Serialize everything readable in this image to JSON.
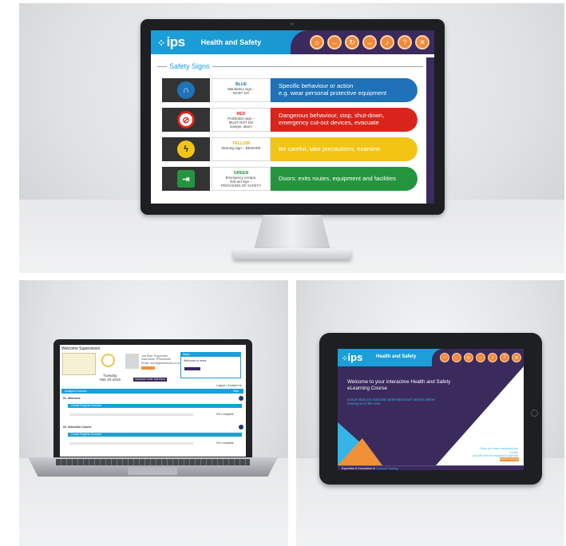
{
  "desktop": {
    "logo": "ips",
    "header_title": "Health and Safety",
    "section_title": "Safety Signs",
    "nav_icons": [
      "home-icon",
      "back-icon",
      "refresh-icon",
      "forward-icon",
      "sound-icon",
      "help-icon",
      "close-icon"
    ],
    "signs": [
      {
        "color_name": "BLUE",
        "desc1": "Mandatory sign –",
        "desc2": "MUST DO",
        "desc3": "",
        "bar_line1": "Specific behaviour or action",
        "bar_line2": "e.g. wear personal protective equipment",
        "color": "#1f72b8",
        "icon": "ear-protection-icon",
        "glyph": "∩"
      },
      {
        "color_name": "RED",
        "desc1": "Prohibition sign –",
        "desc2": "MUST NOT DO",
        "desc3": "Danger, alarm",
        "bar_line1": "Dangerous behaviour, stop, shut-down,",
        "bar_line2": "emergency cut-out devices, evacuate",
        "color": "#d9241c",
        "icon": "no-pedestrian-icon",
        "glyph": "⊘"
      },
      {
        "color_name": "YELLOW",
        "desc1": "Warning sign – BEWARE",
        "desc2": "",
        "desc3": "",
        "bar_line1": "Be careful, take precautions, examine",
        "bar_line2": "",
        "color": "#f2c515",
        "icon": "electric-hazard-icon",
        "glyph": "ϟ"
      },
      {
        "color_name": "GREEN",
        "desc1": "Emergency escape,",
        "desc2": "first-aid sign –",
        "desc3": "PROVISION OF SAFETY",
        "bar_line1": "Doors: exits routes, equipment and facilities",
        "bar_line2": "",
        "color": "#24943e",
        "icon": "emergency-exit-icon",
        "glyph": "→"
      }
    ]
  },
  "laptop": {
    "welcome": "Welcome Supervisors",
    "day": "Tuesday",
    "date": "Mar 20 2019",
    "info_line1": "Job Role: Supervisor",
    "info_line2": "Username: IPSnetwork",
    "info_line3": "Email: user@ipsnetwork.co.uk",
    "button": "CHANGE YOUR JOB ROLE",
    "news_header": "News",
    "news_text": "Welcome to news",
    "logout": "Logout | Contact Us",
    "bar_label": "Assigned Courses",
    "bar_right": "View",
    "course1": "01. Welcome",
    "course1_sub": "Course Progress Overview",
    "course1_pct": "0% Complete",
    "course2": "02. Induction Course",
    "course2_sub": "Course Progress Overview",
    "course2_pct": "0% Complete"
  },
  "tablet": {
    "logo": "ips",
    "header_title": "Health and Safety",
    "nav_icons": [
      "home-icon",
      "back-icon",
      "refresh-icon",
      "forward-icon",
      "sound-icon",
      "help-icon",
      "close-icon"
    ],
    "welcome_line1": "Welcome to your interactive Health and Safety",
    "welcome_line2": "eLearning Course",
    "sub_line1": "Ensure that you read and understand each section before",
    "sub_line2": "moving on to the next.",
    "note_line1": "Once you have completed the course",
    "note_line2": "you will then be required to take the test",
    "begin_button": "BEGIN COURSE",
    "footer_text": "Expertise & Innovation in",
    "footer_link": "Contract Tooling"
  },
  "colors": {
    "blue": "#1b9fd8",
    "purple": "#3b2a5c",
    "orange": "#f18a3a"
  }
}
